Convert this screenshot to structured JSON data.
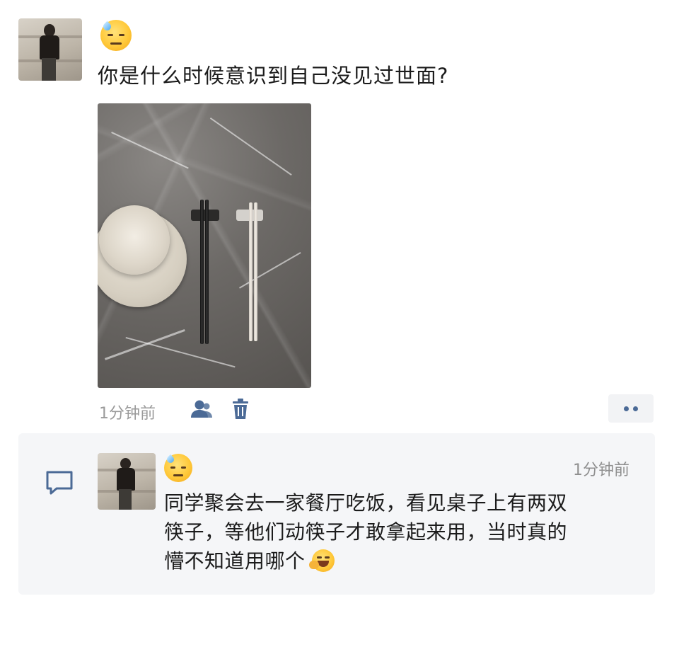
{
  "post": {
    "emoji": "downcast-face-with-sweat",
    "title": "你是什么时候意识到自己没见过世面?",
    "photo_description_icon": "chopsticks-photo",
    "time": "1分钟前",
    "icons": [
      "visibility-icon",
      "delete-icon",
      "more-icon"
    ]
  },
  "comment": {
    "emoji": "downcast-face-with-sweat",
    "time": "1分钟前",
    "text_line1": "同学聚会去一家餐厅吃饭，看见桌子上有两双",
    "text_line2": "筷子，等他们动筷子才敢拿起来用，当时真的",
    "text_line3": "懵不知道用哪个",
    "trailing_emoji": "laughing-face-icon",
    "left_icon": "comment-icon"
  },
  "colors": {
    "accent": "#4b6a96",
    "meta_text": "#9a9a9a",
    "comment_bg": "#f5f6f8"
  }
}
